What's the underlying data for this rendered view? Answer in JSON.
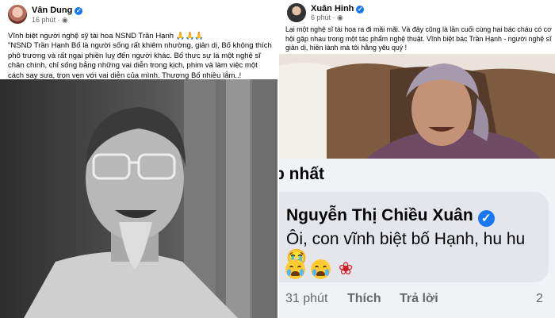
{
  "left_post": {
    "author": "Vân Dung",
    "time": "16 phút",
    "line1": "Vĩnh biệt người nghệ sỹ tài hoa NSND Trần Hạnh 🙏🙏🙏",
    "body": "\"NSND Trần Hạnh Bố là người sống rất khiêm nhường, giản dị, Bố không thích phô trương và rất ngại phiền luỵ đến người khác. Bố thực sự là một nghệ sĩ chân chính, chỉ sống bằng những vai diễn trong kịch, phim và làm việc một cách say sưa, trọn vẹn với vai diễn của mình. Thương Bố nhiều lắm..!"
  },
  "right_post": {
    "author": "Xuân Hinh",
    "time": "6 phút",
    "body": "Lại một nghệ sĩ tài hoa ra đi mãi mãi. Và đây cũng là lần cuối cùng hai bác cháu có cơ hội gặp nhau trong một tác phẩm nghệ thuật. Vĩnh biệt bác Trần Hạnh - người nghệ sĩ giản dị, hiền lành mà tôi hằng yêu quý !"
  },
  "comment": {
    "sort_label": "p nhất",
    "author": "Nguyễn Thị Chiều Xuân",
    "text": "Ôi, con vĩnh biệt bố Hạnh, hu hu 😭",
    "time": "31 phút",
    "like": "Thích",
    "reply": "Trả lời",
    "count": "2"
  },
  "icons": [
    "verified-icon",
    "crying-face-emoji",
    "rose-emoji",
    "pray-emoji"
  ],
  "colors": {
    "verified": "#1877f2",
    "meta": "#65676b",
    "bubble": "#e4e6eb"
  }
}
